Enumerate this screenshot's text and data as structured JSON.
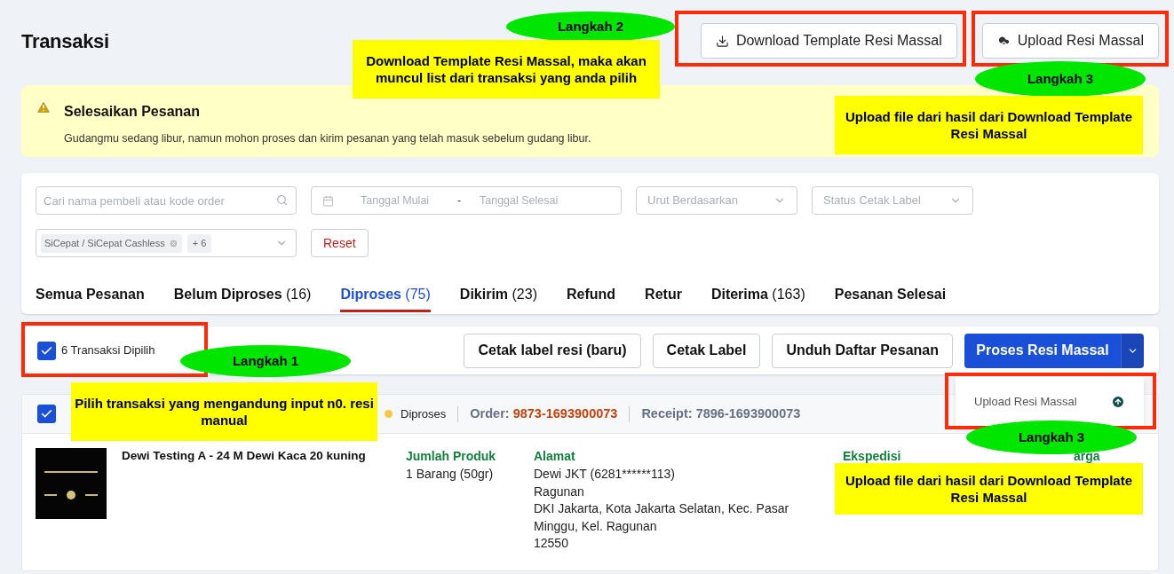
{
  "page": {
    "title": "Transaksi"
  },
  "header_buttons": [
    {
      "kind": "download",
      "label": "Download Template Resi Massal"
    },
    {
      "kind": "upload",
      "label": "Upload Resi Massal"
    }
  ],
  "alert": {
    "title": "Selesaikan Pesanan",
    "message": "Gudangmu sedang libur, namun mohon proses dan kirim pesanan yang telah masuk sebelum gudang libur."
  },
  "filters": {
    "search": {
      "placeholder": "Cari nama pembeli atau kode order"
    },
    "date_range": {
      "start_placeholder": "Tanggal Mulai",
      "separator": "-",
      "end_placeholder": "Tanggal Selesai"
    },
    "sort": {
      "placeholder": "Urut Berdasarkan"
    },
    "label_status": {
      "placeholder": "Status Cetak Label"
    },
    "courier": {
      "tags": [
        "SiCepat / SiCepat Cashless"
      ],
      "more": "+ 6"
    },
    "reset": "Reset"
  },
  "tabs": [
    {
      "label": "Semua Pesanan",
      "selected": false
    },
    {
      "label": "Belum Diproses",
      "count": "(16)",
      "selected": false
    },
    {
      "label": "Diproses",
      "count": "(75)",
      "selected": true
    },
    {
      "label": "Dikirim",
      "count": "(23)",
      "selected": false
    },
    {
      "label": "Refund",
      "selected": false
    },
    {
      "label": "Retur",
      "selected": false
    },
    {
      "label": "Diterima",
      "count": "(163)",
      "selected": false
    },
    {
      "label": "Pesanan Selesai",
      "selected": false
    }
  ],
  "bulk_bar": {
    "checked": true,
    "selection": "6 Transaksi Dipilih",
    "buttons": [
      "Cetak label resi (baru)",
      "Cetak Label",
      "Unduh Daftar Pesanan"
    ],
    "primary_button": "Proses Resi Massal"
  },
  "dropdown_menu": {
    "items": [
      "Upload Resi Massal"
    ]
  },
  "order": {
    "checked": true,
    "status": "Diproses",
    "order_label": "Order:",
    "order_number": "9873-1693900073",
    "receipt": "Receipt: 7896-1693900073",
    "product_name": "Dewi Testing A - 24 M Dewi Kaca 20 kuning",
    "columns": [
      {
        "heading": "Jumlah Produk",
        "lines": [
          "1 Barang (50gr)"
        ]
      },
      {
        "heading": "Alamat",
        "lines": [
          "Dewi JKT (6281******113)",
          "Ragunan",
          "DKI Jakarta, Kota Jakarta Selatan, Kec. Pasar Minggu, Kel. Ragunan",
          "12550"
        ]
      },
      {
        "heading": "Ekspedisi"
      },
      {
        "heading": "arga"
      }
    ]
  },
  "annotations": [
    {
      "kind": "frame"
    },
    {
      "kind": "frame"
    },
    {
      "kind": "frame"
    },
    {
      "kind": "frame"
    },
    {
      "kind": "step",
      "label": "Langkah 2"
    },
    {
      "kind": "note",
      "text": "Download Template Resi Massal, maka akan muncul list dari transaksi yang anda pilih"
    },
    {
      "kind": "step",
      "label": "Langkah 3"
    },
    {
      "kind": "note",
      "text": "Upload file dari hasil dari Download Template Resi Massal"
    },
    {
      "kind": "step",
      "label": "Langkah 1"
    },
    {
      "kind": "note",
      "text": "Pilih transaksi yang mengandung input n0. resi manual"
    },
    {
      "kind": "step",
      "label": "Langkah 3"
    },
    {
      "kind": "note",
      "text": "Upload file dari hasil dari Download Template Resi Massal"
    }
  ]
}
